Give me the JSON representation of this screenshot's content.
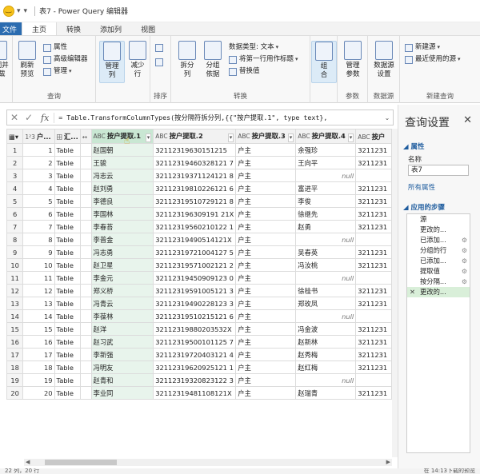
{
  "window": {
    "title": "表7 - Power Query 编辑器"
  },
  "menu": {
    "file": "文件",
    "tabs": [
      "主页",
      "转换",
      "添加列",
      "视图"
    ]
  },
  "ribbon": {
    "close": {
      "label1": "关闭并",
      "label2": "上载"
    },
    "refresh": {
      "label1": "刷新",
      "label2": "预览"
    },
    "properties": "属性",
    "advanced_editor": "高级编辑器",
    "manage": "管理",
    "query_group": "查询",
    "manage_cols": {
      "label1": "管理",
      "label2": "列"
    },
    "reduce_rows": {
      "label1": "减少",
      "label2": "行"
    },
    "sort_group": "排序",
    "split": {
      "label1": "拆分",
      "label2": "列"
    },
    "group_by": {
      "label1": "分组",
      "label2": "依据"
    },
    "data_type": "数据类型: 文本",
    "first_row_header": "将第一行用作标题",
    "replace_values": "替换值",
    "transform_group": "转换",
    "combine": {
      "label1": "组",
      "label2": "合"
    },
    "manage_params": {
      "label1": "管理",
      "label2": "参数"
    },
    "params_group": "参数",
    "data_source": {
      "label1": "数据源",
      "label2": "设置"
    },
    "data_source_group": "数据源",
    "new_source": "新建源",
    "recent_source": "最近使用的源",
    "new_query_group": "新建查询"
  },
  "formula_bar": {
    "text": "= Table.TransformColumnTypes(按分隔符拆分列,{{\"按户提取.1\", type text},"
  },
  "grid": {
    "headers": [
      {
        "type": "1²3",
        "name": "户..."
      },
      {
        "type": "田",
        "name": "汇..."
      },
      {
        "type": "↔",
        "name": ""
      },
      {
        "type": "ABC",
        "name": "按户提取.1"
      },
      {
        "type": "ABC",
        "name": "按户提取.2"
      },
      {
        "type": "ABC",
        "name": "按户提取.3"
      },
      {
        "type": "ABC",
        "name": "按户提取.4"
      },
      {
        "type": "ABC",
        "name": "按户"
      }
    ],
    "rows": [
      [
        "1",
        "1",
        "Table",
        "赵国朝",
        "32112319630151215",
        "户主",
        "余强珍",
        "3211231"
      ],
      [
        "2",
        "2",
        "Table",
        "王骏",
        "32112319460328121 7",
        "户主",
        "王向平",
        "3211231"
      ],
      [
        "3",
        "3",
        "Table",
        "冯志云",
        "32112319371124121 8",
        "户主",
        "null",
        ""
      ],
      [
        "4",
        "4",
        "Table",
        "赵刘勇",
        "32112319810226121 6",
        "户主",
        "富进平",
        "3211231"
      ],
      [
        "5",
        "5",
        "Table",
        "李德良",
        "32112319510729121 8",
        "户主",
        "李俊",
        "3211231"
      ],
      [
        "6",
        "6",
        "Table",
        "李国林",
        "321123196309191 21X",
        "户主",
        "徐继先",
        "3211231"
      ],
      [
        "7",
        "7",
        "Table",
        "李春苔",
        "32112319560210122 1",
        "户主",
        "赵勇",
        "3211231"
      ],
      [
        "8",
        "8",
        "Table",
        "李普金",
        "32112319490514121X",
        "户主",
        "null",
        ""
      ],
      [
        "9",
        "9",
        "Table",
        "冯志勇",
        "32112319721004127 5",
        "户主",
        "吴春英",
        "3211231"
      ],
      [
        "10",
        "10",
        "Table",
        "赵卫星",
        "32112319571002121 2",
        "户主",
        "冯汝桃",
        "3211231"
      ],
      [
        "11",
        "11",
        "Table",
        "李金元",
        "32112319450909123 0",
        "户主",
        "null",
        ""
      ],
      [
        "12",
        "12",
        "Table",
        "郑义桥",
        "32112319591005121 3",
        "户主",
        "徐桂书",
        "3211231"
      ],
      [
        "13",
        "13",
        "Table",
        "冯青云",
        "32112319490228123 3",
        "户主",
        "郑玫凤",
        "3211231"
      ],
      [
        "14",
        "14",
        "Table",
        "李葆林",
        "32112319510215121 6",
        "户主",
        "null",
        ""
      ],
      [
        "15",
        "15",
        "Table",
        "赵洋",
        "32112319880203532X",
        "户主",
        "冯金波",
        "3211231"
      ],
      [
        "16",
        "16",
        "Table",
        "赵习武",
        "32112319500101125 7",
        "户主",
        "赵新林",
        "3211231"
      ],
      [
        "17",
        "17",
        "Table",
        "李新强",
        "32112319720403121 4",
        "户主",
        "赵秀梅",
        "3211231"
      ],
      [
        "18",
        "18",
        "Table",
        "冯明友",
        "32112319620925121 1",
        "户主",
        "赵红梅",
        "3211231"
      ],
      [
        "19",
        "19",
        "Table",
        "赵青和",
        "32112319320823122 3",
        "户主",
        "null",
        ""
      ],
      [
        "20",
        "20",
        "Table",
        "李业同",
        "32112319481108121X",
        "户主",
        "赵瑞青",
        "3211231"
      ]
    ]
  },
  "query_settings": {
    "title": "查询设置",
    "properties_header": "属性",
    "name_label": "名称",
    "name_value": "表7",
    "all_properties": "所有属性",
    "applied_steps_header": "应用的步骤",
    "steps": [
      "源",
      "更改的...",
      "已添加...",
      "分组的行",
      "已添加...",
      "提取值",
      "按分隔...",
      "更改的..."
    ],
    "steps_with_gear": [
      false,
      false,
      true,
      true,
      true,
      true,
      true,
      false
    ],
    "active_step_index": 7
  },
  "status": {
    "left": "22 列，20 行",
    "right": "在 14:13下载的预览"
  }
}
